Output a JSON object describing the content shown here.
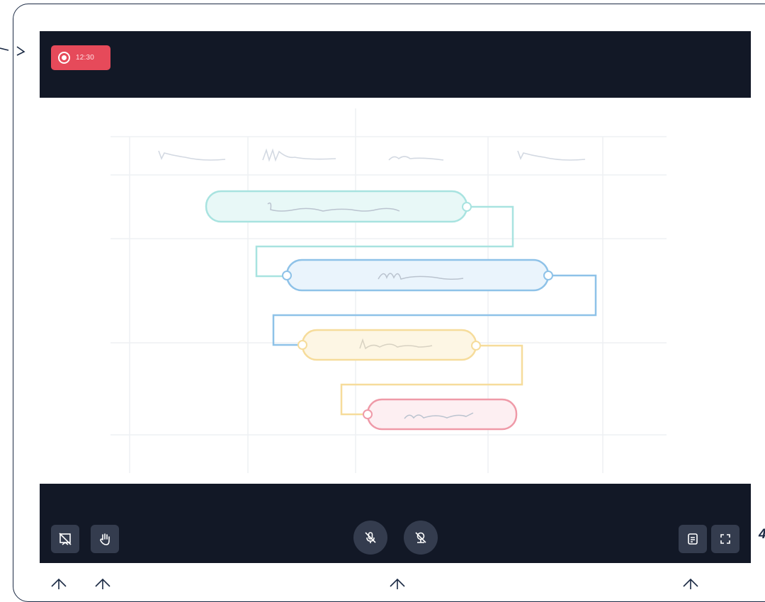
{
  "recording": {
    "time": "12:30"
  },
  "whiteboard": {
    "grid_columns": 4,
    "task_bar_colors": [
      "#80d9d6",
      "#78b4e0",
      "#f3d58a",
      "#ef9aa8"
    ],
    "description_only": false
  },
  "toolbar_left": [
    {
      "icon": "whiteboard-off-icon"
    },
    {
      "icon": "raise-hand-icon"
    }
  ],
  "toolbar_center": [
    {
      "icon": "microphone-off-icon"
    },
    {
      "icon": "camera-off-icon"
    }
  ],
  "toolbar_right": [
    {
      "icon": "notes-icon"
    },
    {
      "icon": "fullscreen-icon"
    }
  ],
  "edge_label": "4",
  "colors": {
    "bar": "#121826",
    "button": "#343c4e",
    "record": "#e64a5a"
  }
}
